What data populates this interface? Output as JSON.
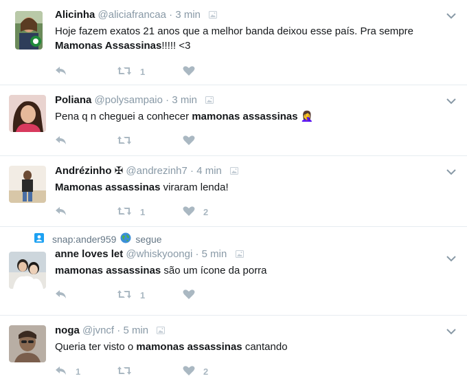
{
  "tweets": [
    {
      "name": "Alicinha",
      "handle": "@aliciafrancaa",
      "time": "3 min",
      "text_parts": [
        "Hoje fazem exatos 21 anos que a melhor banda deixou esse país. Pra sempre ",
        "Mamonas Assassinas",
        "!!!!! <3"
      ],
      "retweets": "1",
      "likes": ""
    },
    {
      "name": "Poliana",
      "handle": "@polysampaio",
      "time": "3 min",
      "text_parts": [
        "Pena q n cheguei a conhecer ",
        "mamonas assassinas",
        " 🤦‍♀️"
      ],
      "retweets": "",
      "likes": ""
    },
    {
      "name": "Andrézinho ✠",
      "handle": "@andrezinh7",
      "time": "4 min",
      "text_parts": [
        "",
        "Mamonas assassinas",
        " viraram lenda!"
      ],
      "retweets": "1",
      "likes": "2"
    },
    {
      "social_context": {
        "user": "snap:ander959",
        "suffix": "segue"
      },
      "name": "anne loves let",
      "handle": "@whiskyoongi",
      "time": "5 min",
      "text_parts": [
        "",
        "mamonas assassinas",
        " são um ícone da porra"
      ],
      "retweets": "1",
      "likes": ""
    },
    {
      "name": "noga",
      "handle": "@jvncf",
      "time": "5 min",
      "text_parts": [
        "Queria ter visto o ",
        "mamonas assassinas",
        " cantando"
      ],
      "replies": "1",
      "retweets": "",
      "likes": "2"
    }
  ],
  "separator": "·",
  "colors": {
    "muted": "#8899a6",
    "action": "#aab8c2",
    "border": "#e6ecf0",
    "badge": "#1da1f2"
  },
  "icons": [
    "reply-icon",
    "retweet-icon",
    "heart-icon",
    "chevron-down-icon",
    "media-badge-icon",
    "person-square-icon",
    "globe-icon"
  ]
}
